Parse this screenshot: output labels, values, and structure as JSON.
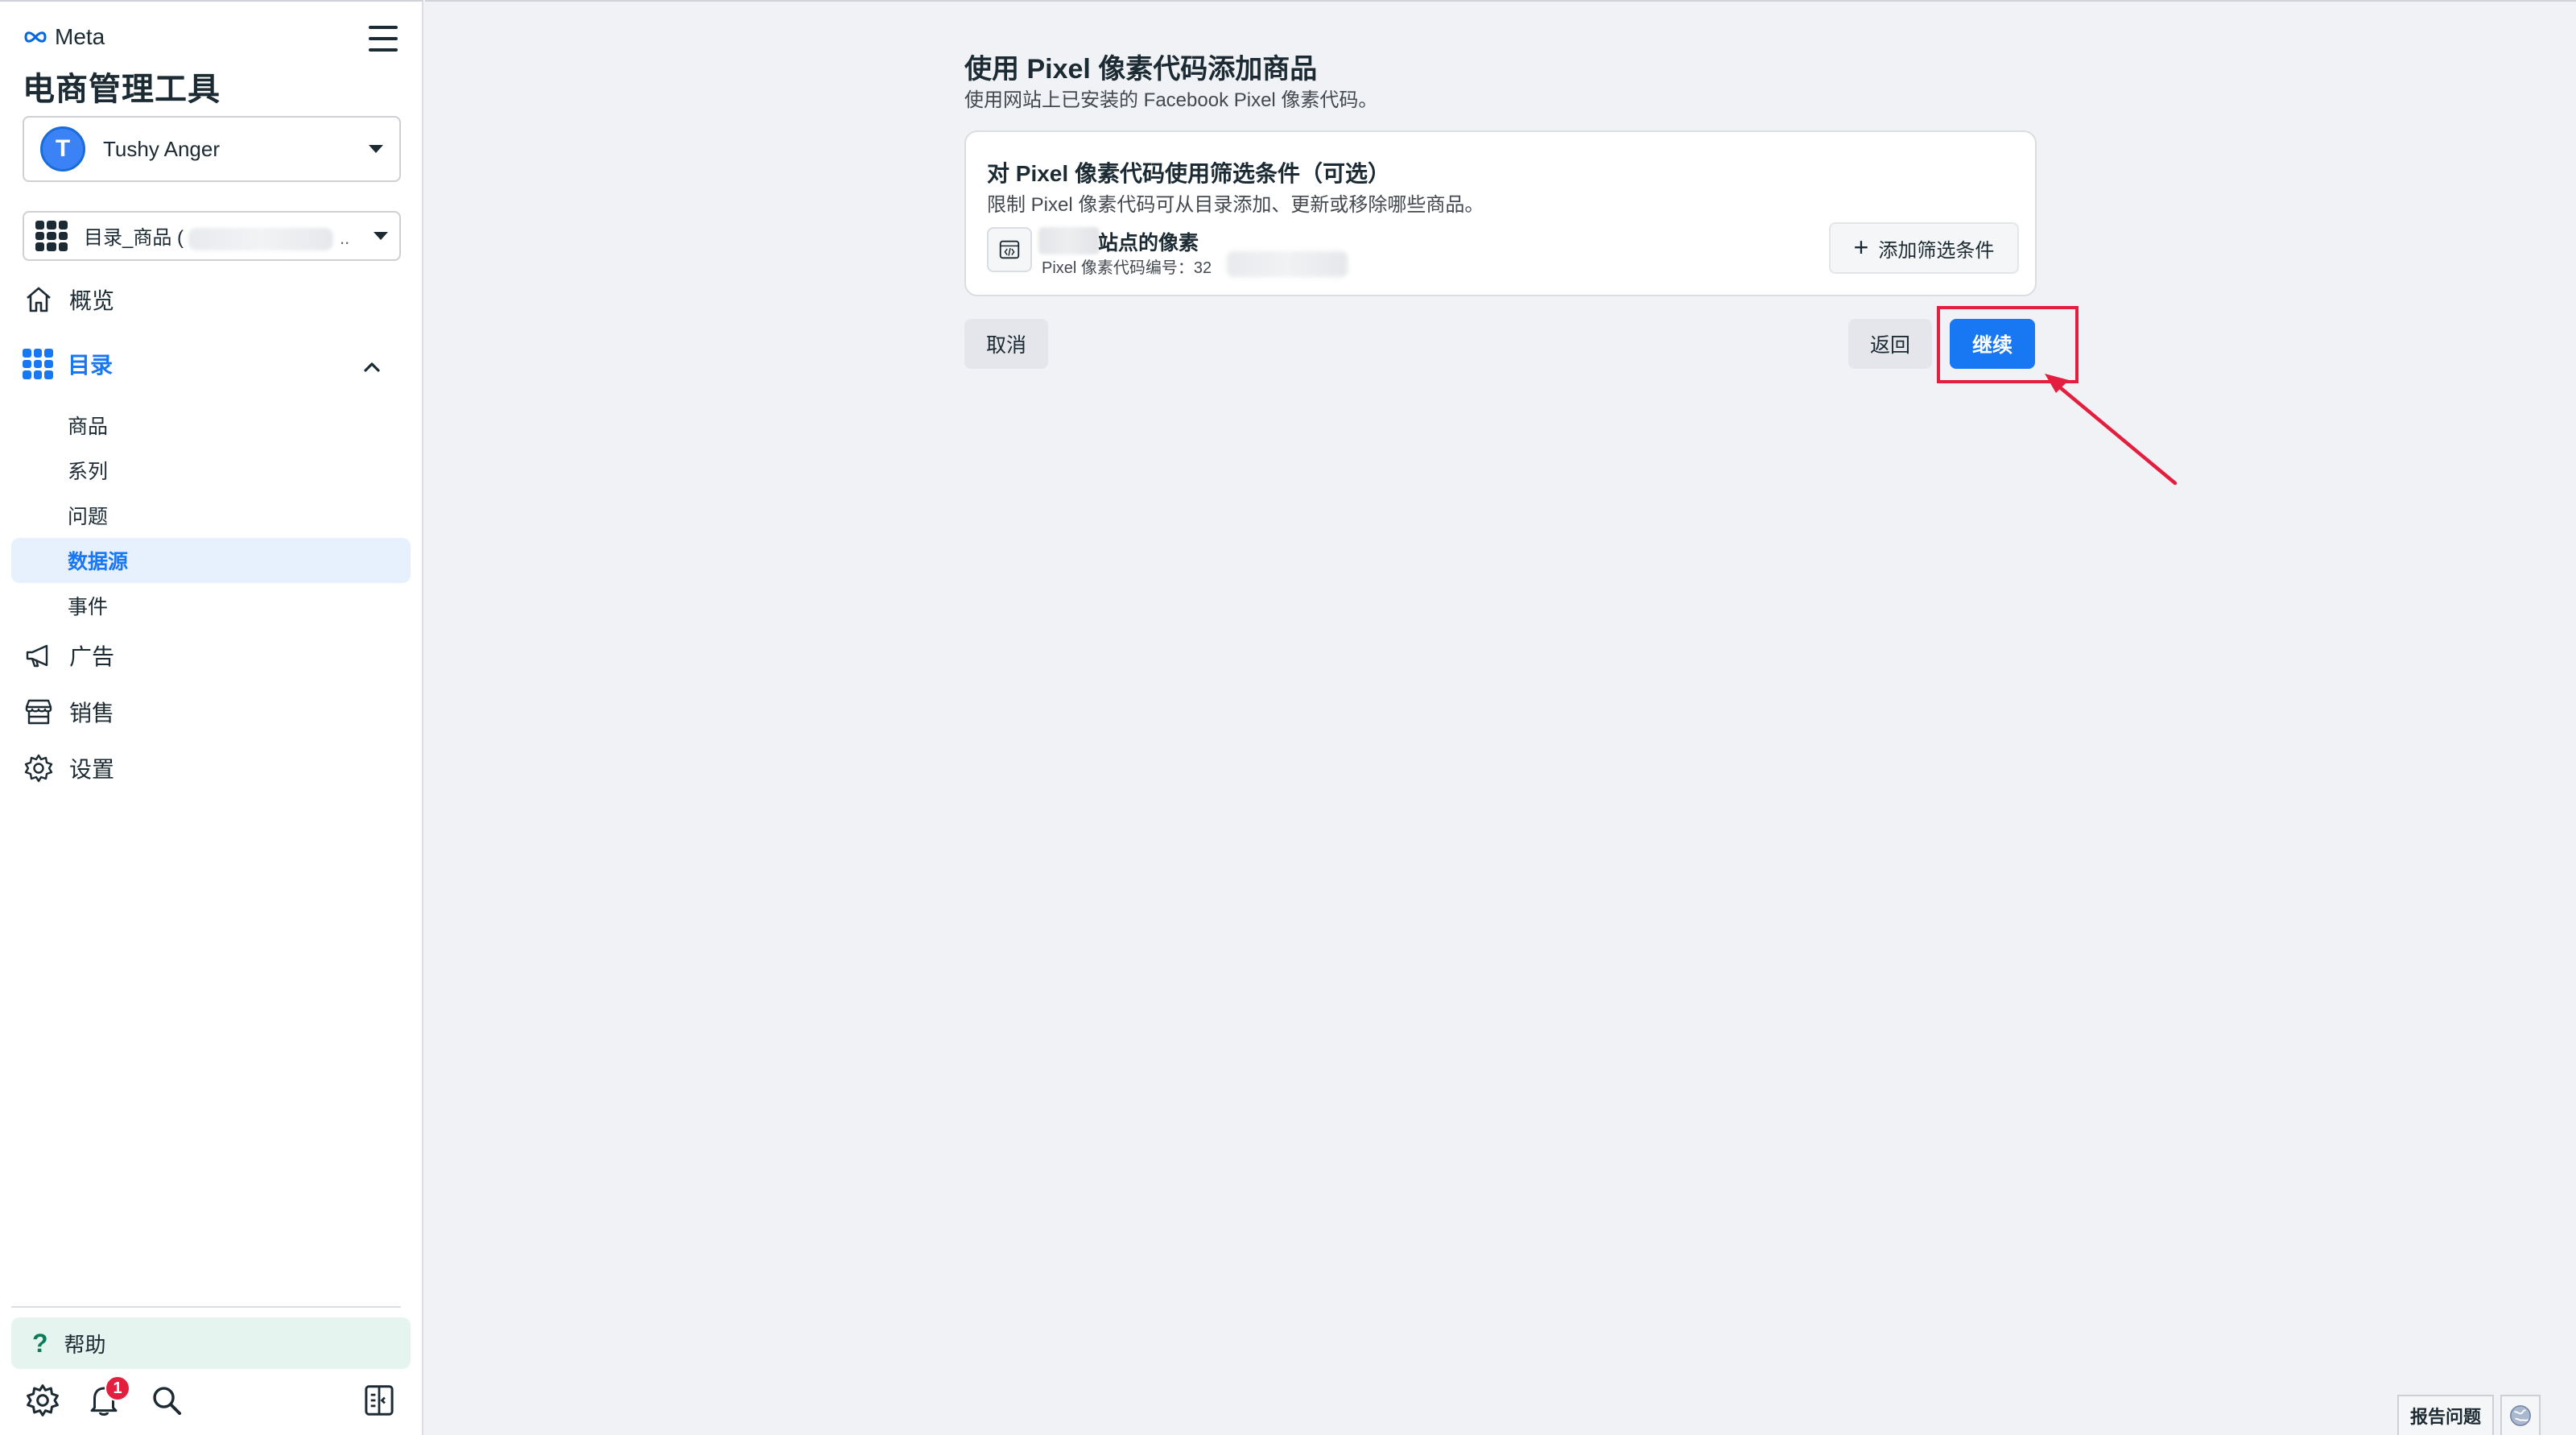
{
  "sidebar": {
    "brand": "Meta",
    "title": "电商管理工具",
    "user": {
      "initial": "T",
      "name": "Tushy Anger"
    },
    "catalog": {
      "label": "目录_商品 (",
      "ellipsis": ".."
    },
    "nav": {
      "overview": "概览",
      "catalog": "目录",
      "ads": "广告",
      "sales": "销售",
      "settings": "设置"
    },
    "catalog_sub": {
      "products": "商品",
      "series": "系列",
      "issues": "问题",
      "data_sources": "数据源",
      "events": "事件"
    },
    "help": {
      "icon": "?",
      "label": "帮助"
    },
    "notifications_count": "1"
  },
  "main": {
    "title": "使用 Pixel 像素代码添加商品",
    "subtitle": "使用网站上已安装的 Facebook Pixel 像素代码。",
    "card": {
      "title": "对 Pixel 像素代码使用筛选条件（可选）",
      "description": "限制 Pixel 像素代码可从目录添加、更新或移除哪些商品。",
      "pixel_name": "站点的像素",
      "pixel_id": "Pixel 像素代码编号：32",
      "add_filter": {
        "icon": "+",
        "label": "添加筛选条件"
      }
    },
    "buttons": {
      "cancel": "取消",
      "back": "返回",
      "continue": "继续"
    }
  },
  "footer": {
    "report": "报告问题"
  },
  "colors": {
    "accent": "#1877f2",
    "annotation": "#e41e3f"
  }
}
